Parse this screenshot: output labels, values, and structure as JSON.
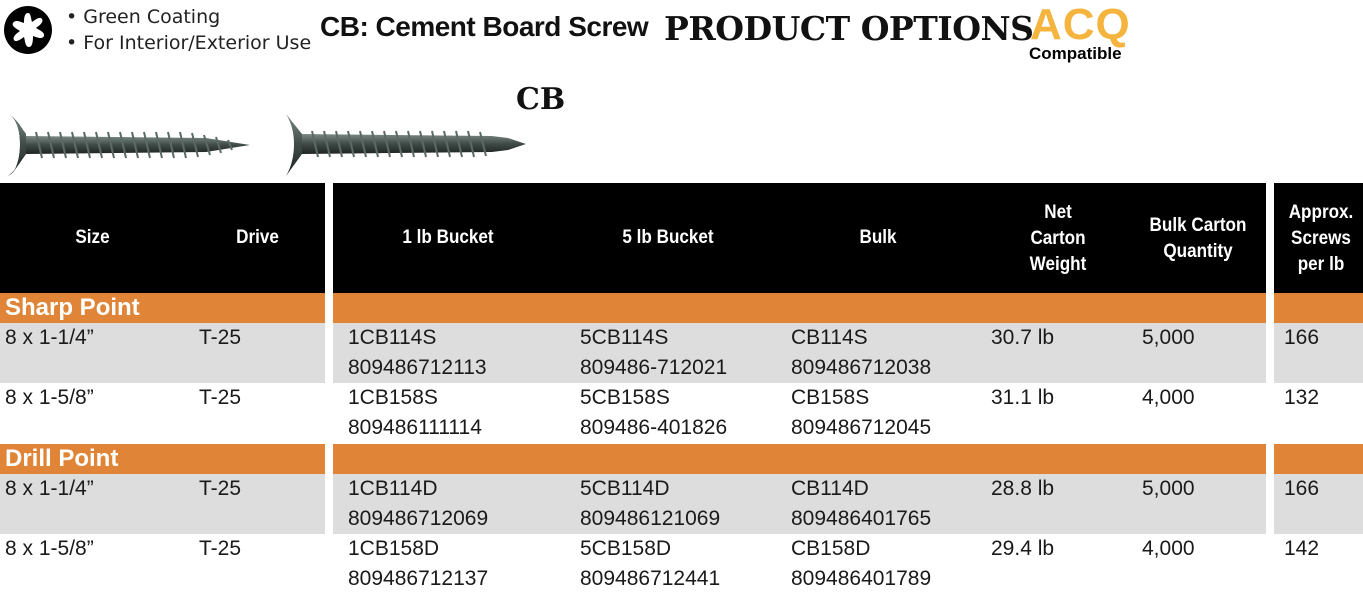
{
  "header": {
    "features": [
      "• Green Coating",
      "• For Interior/Exterior Use"
    ],
    "title": "CB: Cement Board Screw",
    "options_title": "PRODUCT OPTIONS",
    "acq": "ACQ",
    "acq_sub": "Compatible",
    "product_label": "CB",
    "icons": [
      "torx-drive-icon",
      "sharp-point-screw-icon",
      "drill-point-screw-icon"
    ]
  },
  "colors": {
    "accent": "#e08537",
    "header_bg": "#000000",
    "acq": "#f4b43e",
    "row_alt": "#dddddd"
  },
  "table": {
    "columns": [
      "Size",
      "Drive",
      "1 lb Bucket",
      "5 lb Bucket",
      "Bulk",
      "Net Carton Weight",
      "Bulk Carton Quantity",
      "Approx. Screws per lb"
    ],
    "sections": [
      {
        "name": "Sharp Point",
        "rows": [
          {
            "size": "8 x 1-1/4”",
            "drive": "T-25",
            "b1_code": "1CB114S",
            "b1_upc": "809486712113",
            "b5_code": "5CB114S",
            "b5_upc": "809486-712021",
            "bulk_code": "CB114S",
            "bulk_upc": "809486712038",
            "weight": "30.7 lb",
            "qty": "5,000",
            "per_lb": "166"
          },
          {
            "size": "8 x 1-5/8”",
            "drive": "T-25",
            "b1_code": "1CB158S",
            "b1_upc": "809486111114",
            "b5_code": "5CB158S",
            "b5_upc": "809486-401826",
            "bulk_code": "CB158S",
            "bulk_upc": "809486712045",
            "weight": "31.1 lb",
            "qty": "4,000",
            "per_lb": "132"
          }
        ]
      },
      {
        "name": "Drill Point",
        "rows": [
          {
            "size": "8 x 1-1/4”",
            "drive": "T-25",
            "b1_code": "1CB114D",
            "b1_upc": "809486712069",
            "b5_code": "5CB114D",
            "b5_upc": "809486121069",
            "bulk_code": "CB114D",
            "bulk_upc": "809486401765",
            "weight": "28.8 lb",
            "qty": "5,000",
            "per_lb": "166"
          },
          {
            "size": "8 x 1-5/8”",
            "drive": "T-25",
            "b1_code": "1CB158D",
            "b1_upc": "809486712137",
            "b5_code": "5CB158D",
            "b5_upc": "809486712441",
            "bulk_code": "CB158D",
            "bulk_upc": "809486401789",
            "weight": "29.4 lb",
            "qty": "4,000",
            "per_lb": "142"
          }
        ]
      }
    ]
  }
}
